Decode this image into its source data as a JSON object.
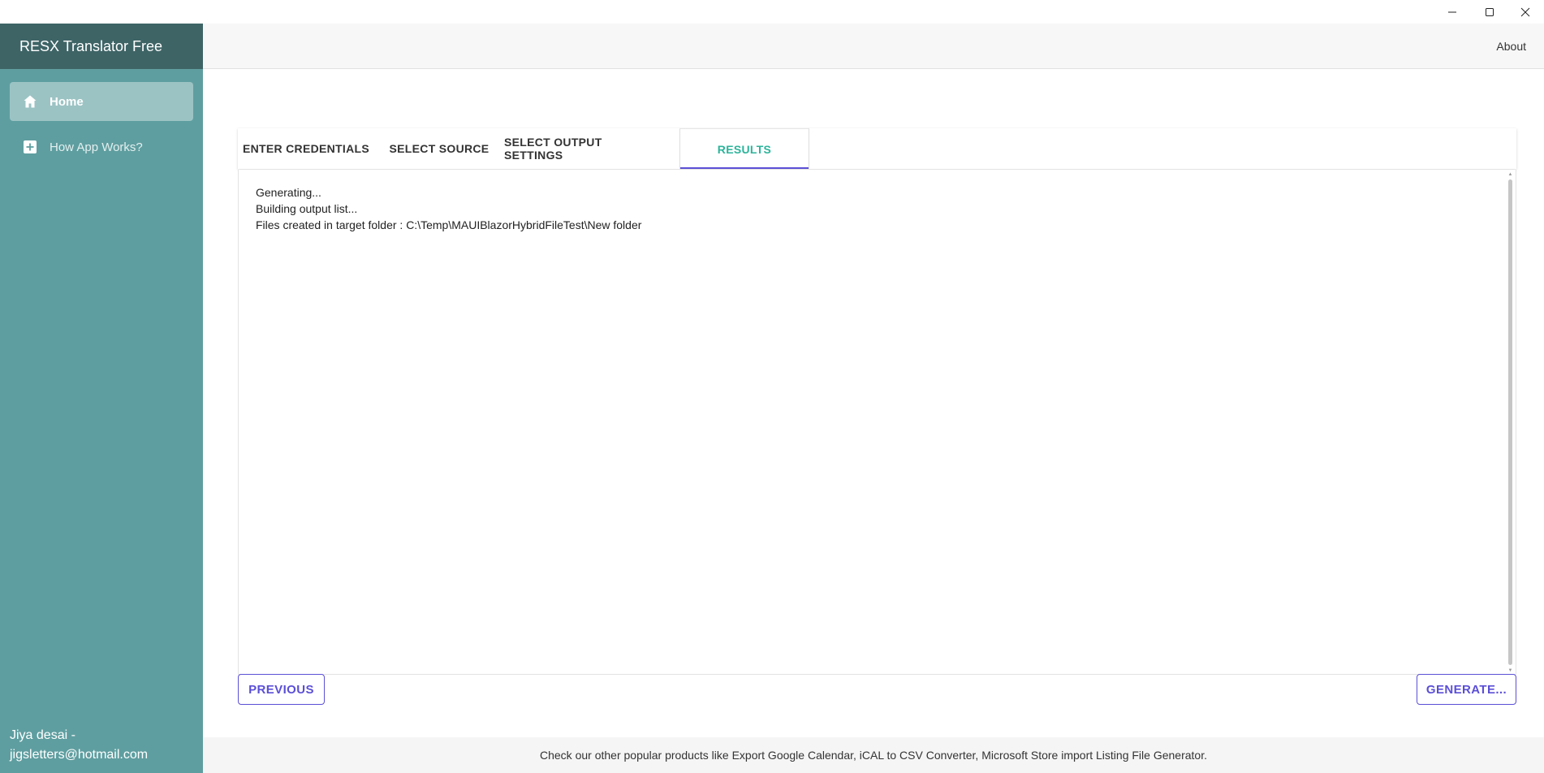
{
  "window": {
    "minimize_icon": "minimize-icon",
    "maximize_icon": "maximize-icon",
    "close_icon": "close-icon"
  },
  "sidebar": {
    "app_title": "RESX Translator Free",
    "items": [
      {
        "label": "Home",
        "icon": "home-icon",
        "active": true
      },
      {
        "label": "How App Works?",
        "icon": "plus-box-icon",
        "active": false
      }
    ],
    "user": {
      "name": "Jiya desai -",
      "email": "jigsletters@hotmail.com"
    }
  },
  "appbar": {
    "about_label": "About"
  },
  "tabs": [
    {
      "label": "ENTER CREDENTIALS",
      "active": false
    },
    {
      "label": "SELECT SOURCE",
      "active": false
    },
    {
      "label": "SELECT OUTPUT SETTINGS",
      "active": false
    },
    {
      "label": "RESULTS",
      "active": true
    }
  ],
  "results": {
    "lines": [
      "Generating...",
      "Building output list...",
      "Files created in target folder : C:\\Temp\\MAUIBlazorHybridFileTest\\New folder"
    ]
  },
  "buttons": {
    "previous_label": "PREVIOUS",
    "generate_label": "GENERATE..."
  },
  "footer": {
    "text": "Check our other popular products like Export Google Calendar, iCAL to CSV Converter, Microsoft Store import Listing File Generator."
  },
  "colors": {
    "sidebar_bg": "#5f9ea0",
    "sidebar_header_bg": "#3e6466",
    "accent_purple": "#5b4fd6",
    "active_tab_text": "#2bb49a"
  }
}
